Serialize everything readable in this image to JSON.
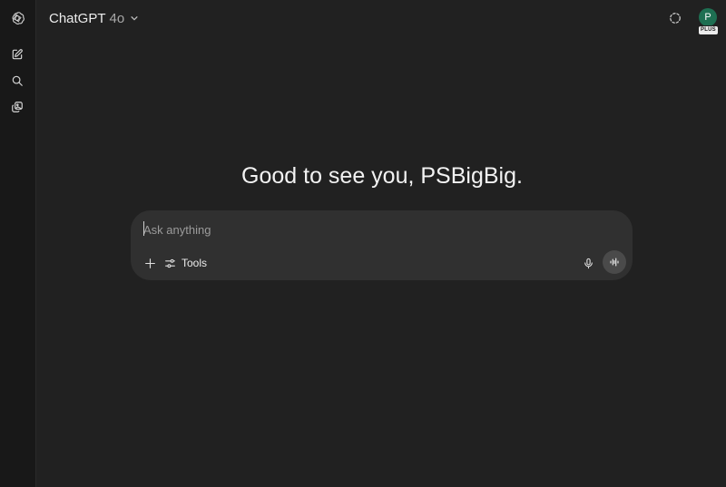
{
  "header": {
    "model_name": "ChatGPT",
    "model_version": "4o",
    "avatar_initial": "P",
    "plan_badge": "PLUS"
  },
  "sidebar": {
    "items": [
      {
        "icon": "openai-logo-icon"
      },
      {
        "icon": "new-chat-icon"
      },
      {
        "icon": "search-icon"
      },
      {
        "icon": "library-icon"
      }
    ]
  },
  "main": {
    "greeting": "Good to see you, PSBigBig."
  },
  "composer": {
    "placeholder": "Ask anything",
    "tools_label": "Tools"
  },
  "colors": {
    "background": "#212121",
    "rail": "#181818",
    "composer": "#303030",
    "avatar": "#1e6f52",
    "voice_button": "#4a4a4a"
  }
}
